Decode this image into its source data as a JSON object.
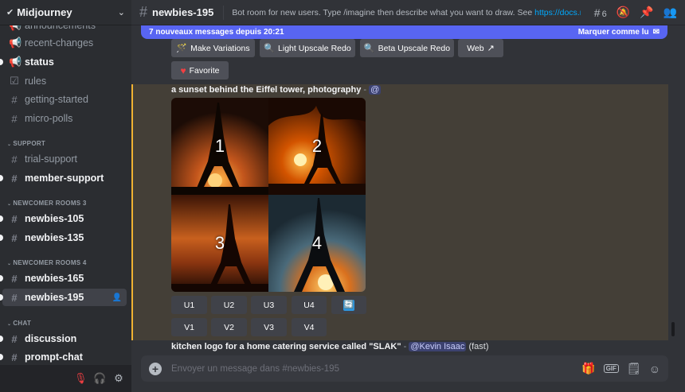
{
  "server": {
    "name": "Midjourney"
  },
  "sidebar": {
    "channels_top": [
      {
        "label": "announcements",
        "icon": "megaphone-icon"
      },
      {
        "label": "recent-changes",
        "icon": "megaphone-icon"
      },
      {
        "label": "status",
        "icon": "megaphone-icon"
      },
      {
        "label": "rules",
        "icon": "checklist-icon"
      },
      {
        "label": "getting-started",
        "icon": "hash-icon"
      },
      {
        "label": "micro-polls",
        "icon": "hash-icon"
      }
    ],
    "categories": [
      {
        "label": "SUPPORT",
        "channels": [
          "trial-support",
          "member-support"
        ]
      },
      {
        "label": "NEWCOMER ROOMS 3",
        "channels": [
          "newbies-105",
          "newbies-135"
        ]
      },
      {
        "label": "NEWCOMER ROOMS 4",
        "channels": [
          "newbies-165",
          "newbies-195"
        ]
      },
      {
        "label": "CHAT",
        "channels": [
          "discussion",
          "prompt-chat"
        ]
      }
    ]
  },
  "header": {
    "channel": "newbies-195",
    "topic": "Bot room for new users. Type /imagine then describe what you want to draw. See ",
    "topic_link": "https://docs.midjourn...",
    "thread_count": "6"
  },
  "banner": {
    "text": "7 nouveaux messages depuis 20:21",
    "action": "Marquer comme lu"
  },
  "message1": {
    "buttons": {
      "make_variations": "Make Variations",
      "light_upscale": "Light Upscale Redo",
      "beta_upscale": "Beta Upscale Redo",
      "web": "Web",
      "favorite": "Favorite"
    }
  },
  "message2": {
    "prompt": "a sunset behind the Eiffel tower, photography",
    "separator": " - ",
    "mention": "@",
    "grid_numbers": [
      "1",
      "2",
      "3",
      "4"
    ],
    "upscale_buttons": [
      "U1",
      "U2",
      "U3",
      "U4"
    ],
    "variation_buttons": [
      "V1",
      "V2",
      "V3",
      "V4"
    ]
  },
  "message3": {
    "prompt": "kitchen logo for a home catering service called \"SLAK\"",
    "separator": " - ",
    "mention": "@Kevin Isaac",
    "speed": "(fast)"
  },
  "composer": {
    "placeholder": "Envoyer un message dans #newbies-195"
  },
  "colors": {
    "accent": "#5865f2",
    "highlight_bar": "#f0b232",
    "link": "#00a8fc"
  }
}
